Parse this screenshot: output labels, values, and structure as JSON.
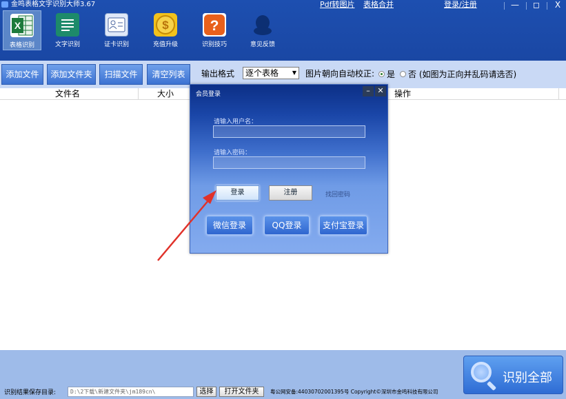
{
  "window": {
    "title": "金鸣表格文字识别大师3.67",
    "links": {
      "pdf_to_image": "Pdf转图片",
      "table_merge": "表格合并",
      "login_register": "登录/注册"
    },
    "controls": {
      "minimize": "—",
      "maximize": "◻",
      "close": "X"
    }
  },
  "toolbar": {
    "items": [
      {
        "label": "表格识别",
        "icon": "excel-icon",
        "active": true
      },
      {
        "label": "文字识别",
        "icon": "document-icon",
        "active": false
      },
      {
        "label": "证卡识别",
        "icon": "id-card-icon",
        "active": false
      },
      {
        "label": "充值升级",
        "icon": "coin-icon",
        "active": false
      },
      {
        "label": "识别技巧",
        "icon": "help-icon",
        "active": false
      },
      {
        "label": "意见反馈",
        "icon": "qq-icon",
        "active": false
      }
    ]
  },
  "actionbar": {
    "add_file": "添加文件",
    "add_folder": "添加文件夹",
    "scan_file": "扫描文件",
    "clear_list": "清空列表",
    "output_format_label": "输出格式",
    "output_format_value": "逐个表格",
    "auto_correct_label": "图片朝向自动校正:",
    "yes": "是",
    "no_hint": "否 (如图为正向并乱码请选否)"
  },
  "file_list": {
    "columns": {
      "name": "文件名",
      "size": "大小",
      "action": "操作"
    }
  },
  "login_dialog": {
    "title": "会员登录",
    "minimize": "–",
    "close": "✕",
    "username_label": "请输入用户名：",
    "password_label": "请输入密码：",
    "login": "登录",
    "register": "注册",
    "forgot_password": "找回密码",
    "wechat_login": "微信登录",
    "qq_login": "QQ登录",
    "alipay_login": "支付宝登录"
  },
  "bottombar": {
    "save_dir_label": "识别结果保存目录:",
    "save_dir_value": "D:\\2下载\\新建文件夹\\jm189cn\\",
    "choose": "选择",
    "open_folder": "打开文件夹",
    "footer": "粤公网安备:44030702001395号 Copyright©深圳市金鸣科技有限公司",
    "recognize_all": "识别全部"
  },
  "colors": {
    "title_bar": "#1d4fb0",
    "action_bar": "#c9d9f5",
    "bottom_bar": "#9ebbe9",
    "annotation_arrow": "#e0322a"
  }
}
